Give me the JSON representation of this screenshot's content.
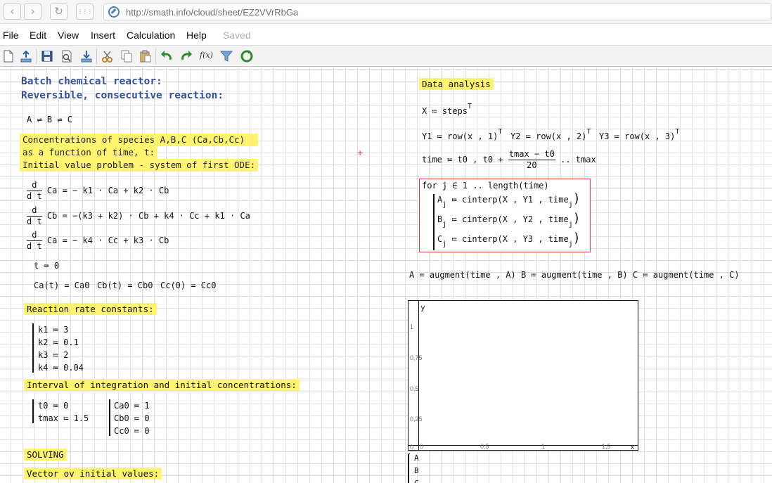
{
  "browser": {
    "url": "http://smath.info/cloud/sheet/EZ2VVrRbGa",
    "back": "‹",
    "forward": "›",
    "reload": "↻",
    "apps": "⋮⋮⋮"
  },
  "menu": {
    "items": [
      "File",
      "Edit",
      "View",
      "Insert",
      "Calculation",
      "Help"
    ],
    "status": "Saved"
  },
  "toolbar": {
    "icons": [
      "new-document-icon",
      "open-icon",
      "save-icon",
      "print-preview-icon",
      "download-icon",
      "cut-icon",
      "copy-icon",
      "paste-icon",
      "undo-icon",
      "redo-icon",
      "function-icon",
      "filter-icon",
      "recalculate-icon"
    ],
    "fx_label": "f(x)"
  },
  "sheet": {
    "title1": "Batch chemical reactor:",
    "title2": "Reversible, consecutive reaction:",
    "scheme": "A ⇌ B ⇌ C",
    "desc1": "Concentrations of species A,B,C (Ca,Cb,Cc)",
    "desc2": "as a function of time, t:",
    "desc3": "Initial value problem - system of first ODE:",
    "ode_d": "d",
    "ode_dt": "d t",
    "ode1": "Ca = − k1 · Ca + k2 · Cb",
    "ode2": "Cb = −(k3 + k2) · Cb + k4 · Cc + k1 · Ca",
    "ode3": "Ca = − k4 · Cc + k3 · Cb",
    "t0": "t = 0",
    "init1": "Ca(t) = Ca0",
    "init2": "Cb(t) = Cb0",
    "init3": "Cc(0) = Cc0",
    "rates_header": "Reaction rate constants:",
    "rates": [
      "k1 ≔ 3",
      "k2 ≔ 0.1",
      "k3 ≔ 2",
      "k4 ≔ 0.04"
    ],
    "interval_header": "Interval of integration and initial concentrations:",
    "interval": [
      "t0 ≔ 0",
      "tmax ≔ 1.5"
    ],
    "conc": [
      "Ca0 ≔ 1",
      "Cb0 ≔ 0",
      "Cc0 ≔ 0"
    ],
    "solving": "SOLVING",
    "vector_header": "Vector ov initial values:",
    "analysis_header": "Data analysis",
    "x_assign": "X ≔ steps",
    "sup_T": "T",
    "y1": "Y1 ≔ row(x , 1)",
    "y2": "Y2 ≔ row(x , 2)",
    "y3": "Y3 ≔ row(x , 3)",
    "time_lhs": "time ≔ t0 , t0 +",
    "time_num": "tmax − t0",
    "time_den": "20",
    "time_rhs": ".. tmax",
    "for_line": "for j ∈ 1 .. length(time)",
    "loop": [
      {
        "var": "A",
        "sub": "j",
        "expr": "≔ cinterp(X , Y1 , time",
        "sub2": "j",
        "close": ")"
      },
      {
        "var": "B",
        "sub": "j",
        "expr": "≔ cinterp(X , Y2 , time",
        "sub2": "j",
        "close": ")"
      },
      {
        "var": "C",
        "sub": "j",
        "expr": "≔ cinterp(X , Y3 , time",
        "sub2": "j",
        "close": ")"
      }
    ],
    "augment": "A ≔ augment(time , A)   B ≔ augment(time , B)   C ≔ augment(time , C)",
    "plot": {
      "y_label": "y",
      "y_ticks": [
        "1",
        "0,75",
        "0,5",
        "0,25"
      ],
      "x_ticks": [
        "0",
        "0,5",
        "1",
        "1,5"
      ],
      "x_origin": "0",
      "x_label": "x",
      "legend": [
        "A",
        "B",
        "C"
      ]
    },
    "cursor": "+"
  }
}
